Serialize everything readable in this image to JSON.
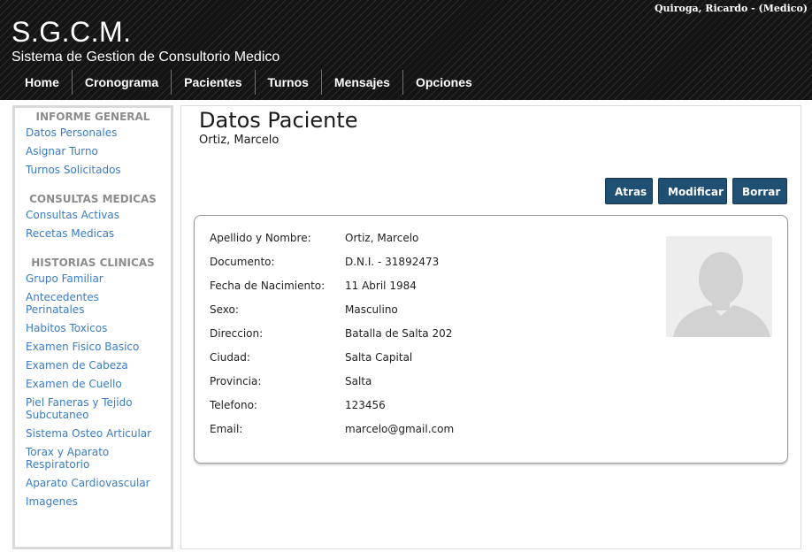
{
  "header": {
    "user": "Quiroga, Ricardo - (Medico)",
    "app_title": "S.G.C.M.",
    "app_subtitle": "Sistema de Gestion de Consultorio Medico",
    "nav": [
      "Home",
      "Cronograma",
      "Pacientes",
      "Turnos",
      "Mensajes",
      "Opciones"
    ]
  },
  "sidebar": {
    "sections": [
      {
        "title": "INFORME GENERAL",
        "links": [
          "Datos Personales",
          "Asignar Turno",
          "Turnos Solicitados"
        ]
      },
      {
        "title": "CONSULTAS MEDICAS",
        "links": [
          "Consultas Activas",
          "Recetas Medicas"
        ]
      },
      {
        "title": "HISTORIAS CLINICAS",
        "links": [
          "Grupo Familiar",
          "Antecedentes Perinatales",
          "Habitos Toxicos",
          "Examen Fisico Basico",
          "Examen de Cabeza",
          "Examen de Cuello",
          "Piel Faneras y Tejido Subcutaneo",
          "Sistema Osteo Articular",
          "Torax y Aparato Respiratorio",
          "Aparato Cardiovascular",
          "Imagenes"
        ]
      }
    ]
  },
  "main": {
    "title": "Datos Paciente",
    "subtitle": "Ortiz, Marcelo",
    "buttons": {
      "back": "Atras",
      "edit": "Modificar",
      "delete": "Borrar"
    },
    "fields": [
      {
        "label": "Apellido y Nombre:",
        "value": "Ortiz, Marcelo"
      },
      {
        "label": "Documento:",
        "value": "D.N.I. - 31892473"
      },
      {
        "label": "Fecha de Nacimiento:",
        "value": "11 Abril 1984"
      },
      {
        "label": "Sexo:",
        "value": "Masculino"
      },
      {
        "label": "Direccion:",
        "value": "Batalla de Salta 202"
      },
      {
        "label": "Ciudad:",
        "value": "Salta Capital"
      },
      {
        "label": "Provincia:",
        "value": "Salta"
      },
      {
        "label": "Telefono:",
        "value": "123456"
      },
      {
        "label": "Email:",
        "value": "marcelo@gmail.com"
      }
    ]
  },
  "colors": {
    "link": "#3a7cc5",
    "button": "#1f4f73",
    "header_bg": "#141414"
  },
  "icons": {
    "photo": "avatar-placeholder-icon"
  }
}
